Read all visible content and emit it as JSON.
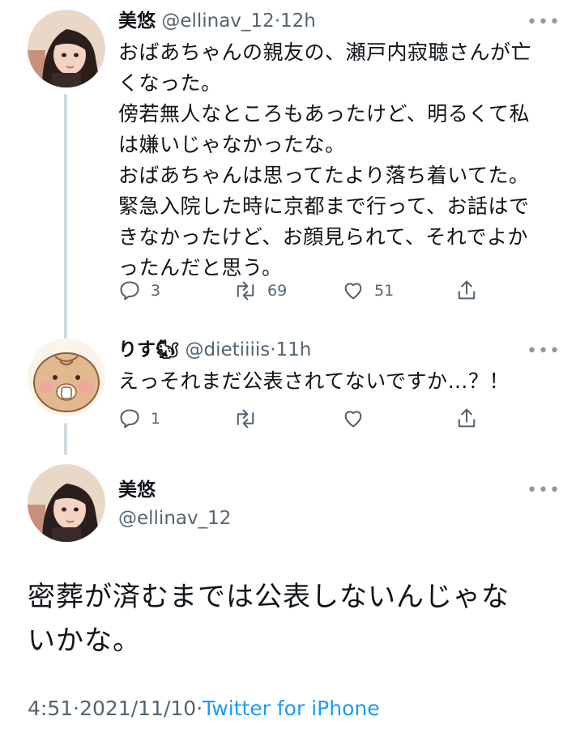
{
  "tweet1": {
    "name": "美悠",
    "handle": "@ellinav_12",
    "sep": "·",
    "time": "12h",
    "text": "おばあちゃんの親友の、瀬戸内寂聴さんが亡\nくなった。\n傍若無人なところもあったけど、明るくて私\nは嫌いじゃなかったな。\nおばあちゃんは思ってたより落ち着いてた。\n緊急入院した時に京都まで行って、お話はで\nきなかったけど、お顔見られて、それでよか\nったんだと思う。",
    "actions": {
      "reply_count": "3",
      "retweet_count": "69",
      "like_count": "51"
    }
  },
  "tweet2": {
    "name": "りす🐿",
    "handle": "@dietiiiis",
    "sep": "·",
    "time": "11h",
    "text": "えっそれまだ公表されてないですか…？！",
    "actions": {
      "reply_count": "1"
    }
  },
  "tweet3": {
    "name": "美悠",
    "handle": "@ellinav_12",
    "text": "密葬が済むまでは公表しないんじゃな\nいかな。",
    "meta": {
      "time": "4:51",
      "sep1": "·",
      "date": "2021/11/10",
      "sep2": "·",
      "source": "Twitter for iPhone"
    }
  },
  "more_glyph": "•••",
  "colors": {
    "text": "#0f1419",
    "secondary": "#536471",
    "link": "#1d9bf0",
    "thread": "#cfd9de"
  }
}
